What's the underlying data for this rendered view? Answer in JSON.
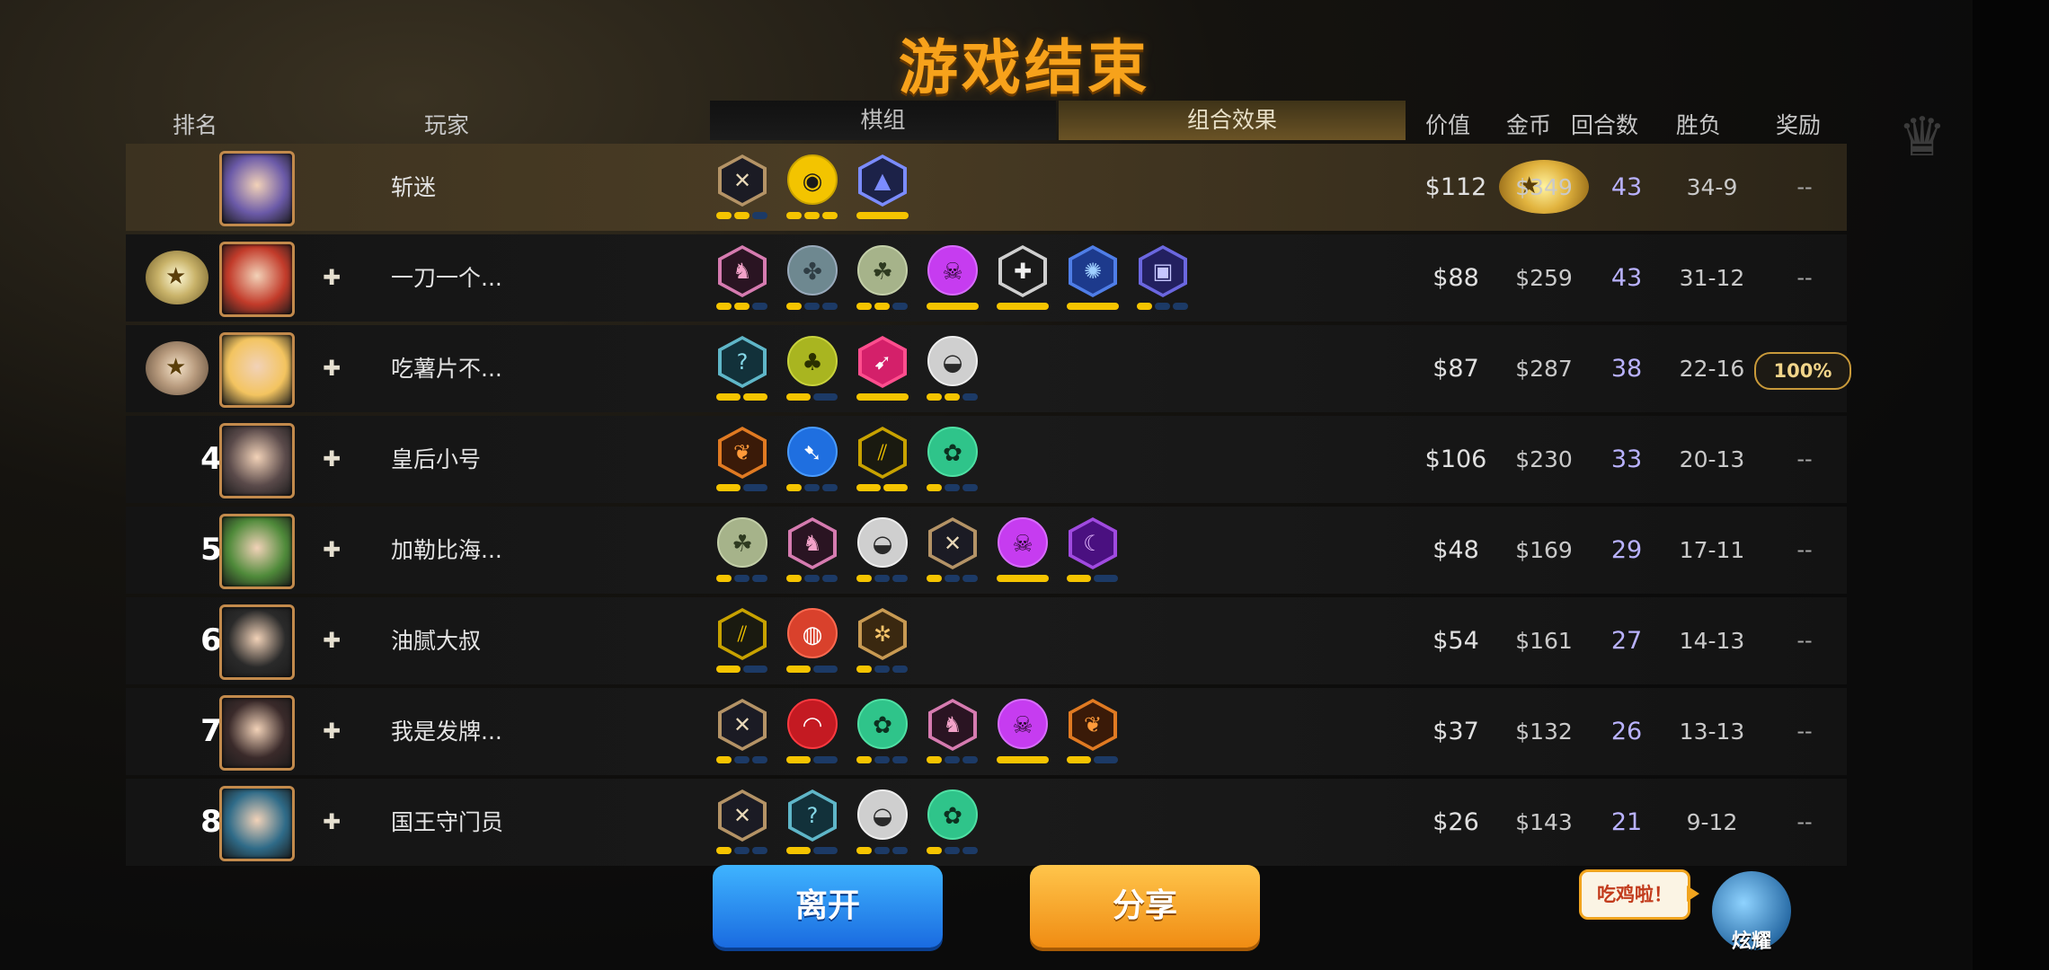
{
  "title": "游戏结束",
  "headers": {
    "rank": "排名",
    "player": "玩家",
    "pieces": "棋组",
    "combo": "组合效果",
    "value": "价值",
    "gold": "金币",
    "rounds": "回合数",
    "winloss": "胜负",
    "reward": "奖励"
  },
  "players": [
    {
      "rank": "",
      "medal": "gold",
      "name": "斩迷",
      "value": "$112",
      "gold": "$349",
      "rounds": "43",
      "wl": "34-9",
      "reward": "--",
      "avatar_color": "#6b5aa8",
      "friend": false,
      "traits": [
        {
          "shape": "hex",
          "icon": "✕",
          "fg": "#e8d8b8",
          "bg": "#1b1b24",
          "rim": "#b49366",
          "pips": [
            1,
            1,
            0
          ]
        },
        {
          "shape": "circ",
          "icon": "◉",
          "fg": "#1a1a1a",
          "bg": "#f3c400",
          "rim": "#caa400",
          "pips": [
            1,
            1,
            1
          ]
        },
        {
          "shape": "hex",
          "icon": "▲",
          "fg": "#7b8cff",
          "bg": "#1c2248",
          "rim": "#7b8cff",
          "pips": [
            1
          ]
        }
      ]
    },
    {
      "rank": "",
      "medal": "silver",
      "name": "一刀一个...",
      "value": "$88",
      "gold": "$259",
      "rounds": "43",
      "wl": "31-12",
      "reward": "--",
      "avatar_color": "#c23b2a",
      "friend": true,
      "traits": [
        {
          "shape": "hex",
          "icon": "♞",
          "fg": "#f2a2c8",
          "bg": "#2a1422",
          "rim": "#d67bb0",
          "pips": [
            1,
            1,
            0
          ]
        },
        {
          "shape": "circ",
          "icon": "✤",
          "fg": "#2f3d44",
          "bg": "#6e8890",
          "rim": "#9ab",
          "pips": [
            1,
            0,
            0
          ]
        },
        {
          "shape": "circ",
          "icon": "☘",
          "fg": "#2e3a20",
          "bg": "#a6b38a",
          "rim": "#c3cfa8",
          "pips": [
            1,
            1,
            0
          ]
        },
        {
          "shape": "circ",
          "icon": "☠",
          "fg": "#2a0a30",
          "bg": "#c63cf0",
          "rim": "#d86cff",
          "pips": [
            1
          ]
        },
        {
          "shape": "hex",
          "icon": "✚",
          "fg": "#f0f0f0",
          "bg": "#1a1a1a",
          "rim": "#cfcfcf",
          "pips": [
            1
          ]
        },
        {
          "shape": "hex",
          "icon": "✺",
          "fg": "#9fd0ff",
          "bg": "#1d3a8c",
          "rim": "#4f7ee8",
          "pips": [
            1
          ]
        },
        {
          "shape": "hex",
          "icon": "▣",
          "fg": "#c6c6ff",
          "bg": "#232060",
          "rim": "#6b67e0",
          "pips": [
            1,
            0,
            0
          ]
        }
      ]
    },
    {
      "rank": "",
      "medal": "bronze",
      "name": "吃薯片不...",
      "value": "$87",
      "gold": "$287",
      "rounds": "38",
      "wl": "22-16",
      "reward": "100%",
      "avatar_color": "#f3c460",
      "friend": true,
      "traits": [
        {
          "shape": "hex",
          "icon": "?",
          "fg": "#86d8e8",
          "bg": "#12313a",
          "rim": "#5fb6c8",
          "pips": [
            1,
            1
          ]
        },
        {
          "shape": "circ",
          "icon": "♣",
          "fg": "#2a3000",
          "bg": "#a9b520",
          "rim": "#c8d23c",
          "pips": [
            1,
            0
          ]
        },
        {
          "shape": "hex",
          "icon": "➹",
          "fg": "#ffffff",
          "bg": "#d4206a",
          "rim": "#ff4e8e",
          "pips": [
            1
          ]
        },
        {
          "shape": "circ",
          "icon": "◒",
          "fg": "#2a2a2a",
          "bg": "#cfcfcf",
          "rim": "#eee",
          "pips": [
            1,
            1,
            0
          ]
        }
      ]
    },
    {
      "rank": "4",
      "medal": "",
      "name": "皇后小号",
      "value": "$106",
      "gold": "$230",
      "rounds": "33",
      "wl": "20-13",
      "reward": "--",
      "avatar_color": "#5a4a4a",
      "friend": true,
      "traits": [
        {
          "shape": "hex",
          "icon": "❦",
          "fg": "#ff9a3a",
          "bg": "#3a1a08",
          "rim": "#e07a22",
          "pips": [
            1,
            0
          ]
        },
        {
          "shape": "circ",
          "icon": "➷",
          "fg": "#ffffff",
          "bg": "#1f6fe0",
          "rim": "#4a9bff",
          "pips": [
            1,
            0,
            0
          ]
        },
        {
          "shape": "hex",
          "icon": "⫽",
          "fg": "#f3c400",
          "bg": "#1a1a10",
          "rim": "#c8a200",
          "pips": [
            1,
            1
          ]
        },
        {
          "shape": "circ",
          "icon": "✿",
          "fg": "#0d3020",
          "bg": "#2fc48a",
          "rim": "#4fe0a4",
          "pips": [
            1,
            0,
            0
          ]
        }
      ]
    },
    {
      "rank": "5",
      "medal": "",
      "name": "加勒比海...",
      "value": "$48",
      "gold": "$169",
      "rounds": "29",
      "wl": "17-11",
      "reward": "--",
      "avatar_color": "#4f8a3a",
      "friend": true,
      "traits": [
        {
          "shape": "circ",
          "icon": "☘",
          "fg": "#2e3a20",
          "bg": "#a6b38a",
          "rim": "#c3cfa8",
          "pips": [
            1,
            0,
            0
          ]
        },
        {
          "shape": "hex",
          "icon": "♞",
          "fg": "#f2a2c8",
          "bg": "#2a1422",
          "rim": "#d67bb0",
          "pips": [
            1,
            0,
            0
          ]
        },
        {
          "shape": "circ",
          "icon": "◒",
          "fg": "#2a2a2a",
          "bg": "#cfcfcf",
          "rim": "#eee",
          "pips": [
            1,
            0,
            0
          ]
        },
        {
          "shape": "hex",
          "icon": "✕",
          "fg": "#e8d8b8",
          "bg": "#1b1b24",
          "rim": "#b49366",
          "pips": [
            1,
            0,
            0
          ]
        },
        {
          "shape": "circ",
          "icon": "☠",
          "fg": "#2a0a30",
          "bg": "#c63cf0",
          "rim": "#d86cff",
          "pips": [
            1
          ]
        },
        {
          "shape": "hex",
          "icon": "☾",
          "fg": "#e4b8ff",
          "bg": "#4a1080",
          "rim": "#a04ae0",
          "pips": [
            1,
            0
          ]
        }
      ]
    },
    {
      "rank": "6",
      "medal": "",
      "name": "油腻大叔",
      "value": "$54",
      "gold": "$161",
      "rounds": "27",
      "wl": "14-13",
      "reward": "--",
      "avatar_color": "#2a2a2a",
      "friend": true,
      "traits": [
        {
          "shape": "hex",
          "icon": "⫽",
          "fg": "#f3c400",
          "bg": "#1a1a10",
          "rim": "#c8a200",
          "pips": [
            1,
            0
          ]
        },
        {
          "shape": "circ",
          "icon": "◍",
          "fg": "#fff",
          "bg": "#d9412c",
          "rim": "#ff6a50",
          "pips": [
            1,
            0
          ]
        },
        {
          "shape": "hex",
          "icon": "✲",
          "fg": "#f6c46a",
          "bg": "#3a2810",
          "rim": "#c89a52",
          "pips": [
            1,
            0,
            0
          ]
        }
      ]
    },
    {
      "rank": "7",
      "medal": "",
      "name": "我是发牌...",
      "value": "$37",
      "gold": "$132",
      "rounds": "26",
      "wl": "13-13",
      "reward": "--",
      "avatar_color": "#3a2a2a",
      "friend": true,
      "traits": [
        {
          "shape": "hex",
          "icon": "✕",
          "fg": "#e8d8b8",
          "bg": "#1b1b24",
          "rim": "#b49366",
          "pips": [
            1,
            0,
            0
          ]
        },
        {
          "shape": "circ",
          "icon": "◠",
          "fg": "#fff",
          "bg": "#c41a22",
          "rim": "#ff3a40",
          "pips": [
            1,
            0
          ]
        },
        {
          "shape": "circ",
          "icon": "✿",
          "fg": "#0d3020",
          "bg": "#2fc48a",
          "rim": "#4fe0a4",
          "pips": [
            1,
            0,
            0
          ]
        },
        {
          "shape": "hex",
          "icon": "♞",
          "fg": "#f2a2c8",
          "bg": "#2a1422",
          "rim": "#d67bb0",
          "pips": [
            1,
            0,
            0
          ]
        },
        {
          "shape": "circ",
          "icon": "☠",
          "fg": "#2a0a30",
          "bg": "#c63cf0",
          "rim": "#d86cff",
          "pips": [
            1
          ]
        },
        {
          "shape": "hex",
          "icon": "❦",
          "fg": "#ff9a3a",
          "bg": "#3a1a08",
          "rim": "#e07a22",
          "pips": [
            1,
            0
          ]
        }
      ]
    },
    {
      "rank": "8",
      "medal": "",
      "name": "国王守门员",
      "value": "$26",
      "gold": "$143",
      "rounds": "21",
      "wl": "9-12",
      "reward": "--",
      "avatar_color": "#2f6b88",
      "friend": true,
      "traits": [
        {
          "shape": "hex",
          "icon": "✕",
          "fg": "#e8d8b8",
          "bg": "#1b1b24",
          "rim": "#b49366",
          "pips": [
            1,
            0,
            0
          ]
        },
        {
          "shape": "hex",
          "icon": "?",
          "fg": "#86d8e8",
          "bg": "#12313a",
          "rim": "#5fb6c8",
          "pips": [
            1,
            0
          ]
        },
        {
          "shape": "circ",
          "icon": "◒",
          "fg": "#2a2a2a",
          "bg": "#cfcfcf",
          "rim": "#eee",
          "pips": [
            1,
            0,
            0
          ]
        },
        {
          "shape": "circ",
          "icon": "✿",
          "fg": "#0d3020",
          "bg": "#2fc48a",
          "rim": "#4fe0a4",
          "pips": [
            1,
            0,
            0
          ]
        }
      ]
    }
  ],
  "buttons": {
    "leave": "离开",
    "share": "分享"
  },
  "brag": {
    "bubble": "吃鸡啦！",
    "label": "炫耀"
  }
}
